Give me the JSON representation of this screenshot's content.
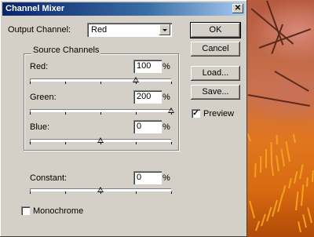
{
  "window": {
    "title": "Channel Mixer",
    "close_glyph": "✕"
  },
  "output_channel": {
    "label": "Output Channel:",
    "value": "Red"
  },
  "source_channels": {
    "title": "Source Channels",
    "red": {
      "label": "Red:",
      "value": "100",
      "unit": "%",
      "slider_level": 100
    },
    "green": {
      "label": "Green:",
      "value": "200",
      "unit": "%",
      "slider_level": 200
    },
    "blue": {
      "label": "Blue:",
      "value": "0",
      "unit": "%",
      "slider_level": 0
    }
  },
  "constant": {
    "label": "Constant:",
    "value": "0",
    "unit": "%",
    "slider_level": 0
  },
  "monochrome": {
    "label": "Monochrome",
    "checked": false
  },
  "buttons": {
    "ok": "OK",
    "cancel": "Cancel",
    "load": "Load...",
    "save": "Save..."
  },
  "preview": {
    "label": "Preview",
    "checked": true,
    "check_glyph": "✓"
  }
}
